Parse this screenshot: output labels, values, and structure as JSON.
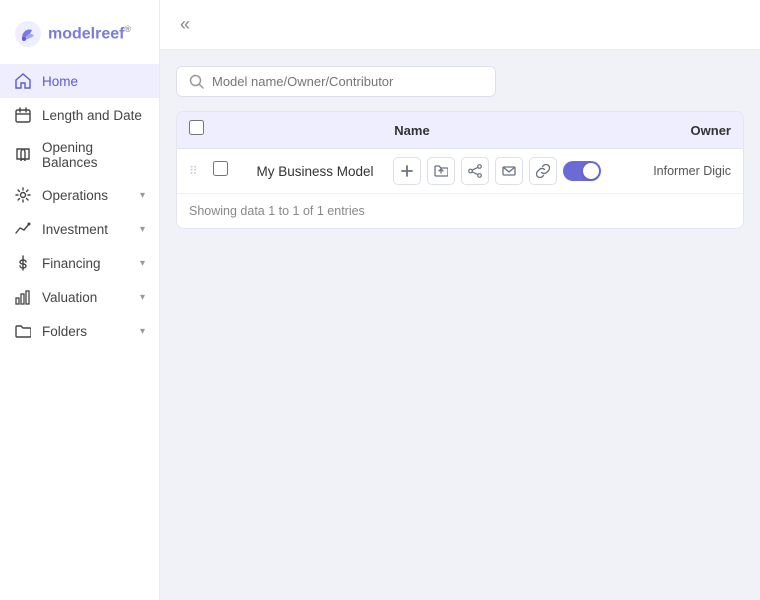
{
  "brand": {
    "logo_text": "modelreef",
    "logo_tm": "®"
  },
  "sidebar": {
    "collapse_btn": "«",
    "items": [
      {
        "id": "home",
        "label": "Home",
        "icon": "home-icon",
        "active": true,
        "has_chevron": false
      },
      {
        "id": "length-date",
        "label": "Length and Date",
        "icon": "calendar-icon",
        "active": false,
        "has_chevron": false
      },
      {
        "id": "opening-balances",
        "label": "Opening Balances",
        "icon": "book-icon",
        "active": false,
        "has_chevron": false
      },
      {
        "id": "operations",
        "label": "Operations",
        "icon": "settings-icon",
        "active": false,
        "has_chevron": true
      },
      {
        "id": "investment",
        "label": "Investment",
        "icon": "chart-icon",
        "active": false,
        "has_chevron": true
      },
      {
        "id": "financing",
        "label": "Financing",
        "icon": "dollar-icon",
        "active": false,
        "has_chevron": true
      },
      {
        "id": "valuation",
        "label": "Valuation",
        "icon": "chart2-icon",
        "active": false,
        "has_chevron": true
      },
      {
        "id": "folders",
        "label": "Folders",
        "icon": "folder-icon",
        "active": false,
        "has_chevron": true
      }
    ]
  },
  "search": {
    "placeholder": "Model name/Owner/Contributor"
  },
  "table": {
    "columns": [
      {
        "id": "name",
        "label": "Name"
      },
      {
        "id": "owner",
        "label": "Owner"
      }
    ],
    "rows": [
      {
        "name": "My Business Model",
        "owner": "Informer Digic",
        "enabled": true
      }
    ],
    "entries_info": "Showing data 1 to 1 of 1 entries"
  },
  "action_buttons": [
    {
      "id": "add-btn",
      "icon": "plus-icon",
      "symbol": "+"
    },
    {
      "id": "folder-btn",
      "icon": "folder-arrow-icon",
      "symbol": "⤴"
    },
    {
      "id": "share-btn",
      "icon": "share-icon",
      "symbol": "⑂"
    },
    {
      "id": "email-btn",
      "icon": "email-icon",
      "symbol": "✉"
    },
    {
      "id": "link-btn",
      "icon": "link-icon",
      "symbol": "🔗"
    }
  ]
}
